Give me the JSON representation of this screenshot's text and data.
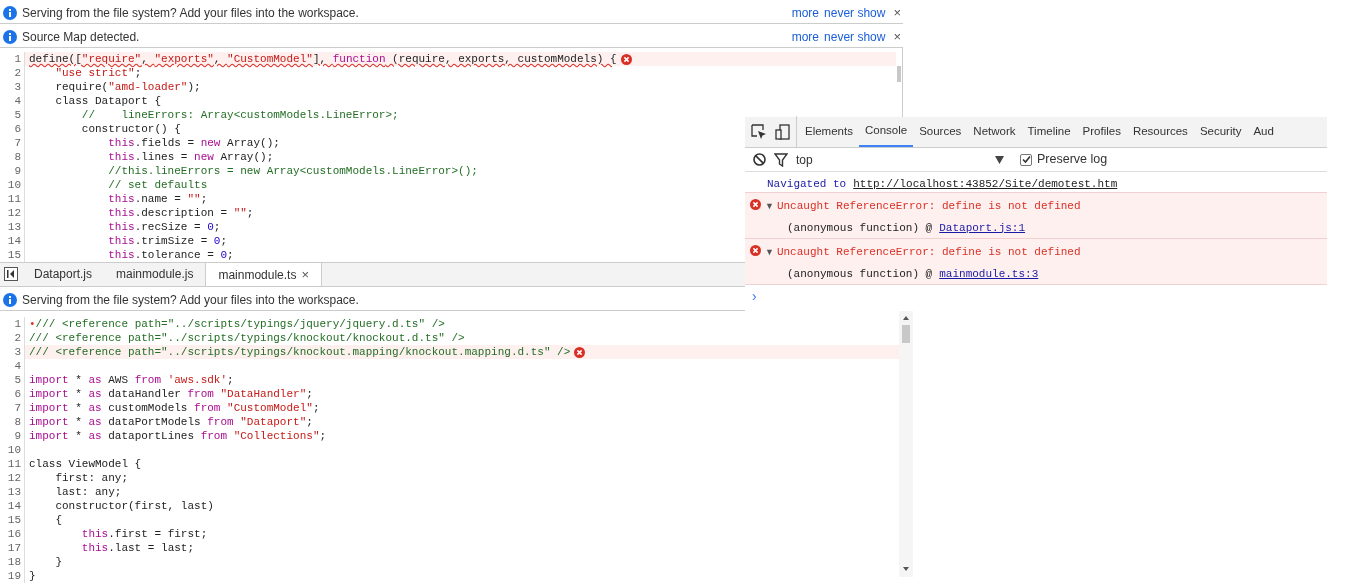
{
  "editor_top": {
    "info_bars": [
      {
        "text": "Serving from the file system? Add your files into the workspace.",
        "links": [
          "more",
          "never show"
        ],
        "close": "×"
      },
      {
        "text": "Source Map detected.",
        "links": [
          "more",
          "never show"
        ],
        "close": "×"
      }
    ],
    "lines": [
      {
        "number": "1",
        "error": true,
        "tokens": [
          {
            "kind": "plain",
            "text": "define(["
          },
          {
            "kind": "string",
            "text": "\"require\""
          },
          {
            "kind": "plain",
            "text": ", "
          },
          {
            "kind": "string",
            "text": "\"exports\""
          },
          {
            "kind": "plain",
            "text": ", "
          },
          {
            "kind": "string",
            "text": "\"CustomModel\""
          },
          {
            "kind": "plain",
            "text": "], "
          },
          {
            "kind": "keyword",
            "text": "function"
          },
          {
            "kind": "plain",
            "text": " (require, exports, customModels) {"
          }
        ]
      },
      {
        "number": "2",
        "error": false,
        "tokens": [
          {
            "kind": "string",
            "text": "    \"use strict\""
          },
          {
            "kind": "plain",
            "text": ";"
          }
        ]
      },
      {
        "number": "3",
        "error": false,
        "tokens": [
          {
            "kind": "plain",
            "text": "    require("
          },
          {
            "kind": "string",
            "text": "\"amd-loader\""
          },
          {
            "kind": "plain",
            "text": ");"
          }
        ]
      },
      {
        "number": "4",
        "error": false,
        "tokens": [
          {
            "kind": "plain",
            "text": "    class Dataport {"
          }
        ]
      },
      {
        "number": "5",
        "error": false,
        "tokens": [
          {
            "kind": "comment",
            "text": "        //    lineErrors: Array<customModels.LineError>;"
          }
        ]
      },
      {
        "number": "6",
        "error": false,
        "tokens": [
          {
            "kind": "plain",
            "text": "        constructor() {"
          }
        ]
      },
      {
        "number": "7",
        "error": false,
        "tokens": [
          {
            "kind": "keyword",
            "text": "            this"
          },
          {
            "kind": "plain",
            "text": ".fields = "
          },
          {
            "kind": "keyword",
            "text": "new"
          },
          {
            "kind": "plain",
            "text": " Array();"
          }
        ]
      },
      {
        "number": "8",
        "error": false,
        "tokens": [
          {
            "kind": "keyword",
            "text": "            this"
          },
          {
            "kind": "plain",
            "text": ".lines = "
          },
          {
            "kind": "keyword",
            "text": "new"
          },
          {
            "kind": "plain",
            "text": " Array();"
          }
        ]
      },
      {
        "number": "9",
        "error": false,
        "tokens": [
          {
            "kind": "comment",
            "text": "            //this.lineErrors = new Array<customModels.LineError>();"
          }
        ]
      },
      {
        "number": "10",
        "error": false,
        "tokens": [
          {
            "kind": "comment",
            "text": "            // set defaults"
          }
        ]
      },
      {
        "number": "11",
        "error": false,
        "tokens": [
          {
            "kind": "keyword",
            "text": "            this"
          },
          {
            "kind": "plain",
            "text": ".name = "
          },
          {
            "kind": "string",
            "text": "\"\""
          },
          {
            "kind": "plain",
            "text": ";"
          }
        ]
      },
      {
        "number": "12",
        "error": false,
        "tokens": [
          {
            "kind": "keyword",
            "text": "            this"
          },
          {
            "kind": "plain",
            "text": ".description = "
          },
          {
            "kind": "string",
            "text": "\"\""
          },
          {
            "kind": "plain",
            "text": ";"
          }
        ]
      },
      {
        "number": "13",
        "error": false,
        "tokens": [
          {
            "kind": "keyword",
            "text": "            this"
          },
          {
            "kind": "plain",
            "text": ".recSize = "
          },
          {
            "kind": "number",
            "text": "0"
          },
          {
            "kind": "plain",
            "text": ";"
          }
        ]
      },
      {
        "number": "14",
        "error": false,
        "tokens": [
          {
            "kind": "keyword",
            "text": "            this"
          },
          {
            "kind": "plain",
            "text": ".trimSize = "
          },
          {
            "kind": "number",
            "text": "0"
          },
          {
            "kind": "plain",
            "text": ";"
          }
        ]
      },
      {
        "number": "15",
        "error": false,
        "tokens": [
          {
            "kind": "keyword",
            "text": "            this"
          },
          {
            "kind": "plain",
            "text": ".tolerance = "
          },
          {
            "kind": "number",
            "text": "0"
          },
          {
            "kind": "plain",
            "text": ";"
          }
        ]
      }
    ]
  },
  "tabs": [
    {
      "label": "Dataport.js",
      "selected": false
    },
    {
      "label": "mainmodule.js",
      "selected": false
    },
    {
      "label": "mainmodule.ts",
      "selected": true,
      "close": "×"
    }
  ],
  "editor_bottom": {
    "info_bar": {
      "text": "Serving from the file system? Add your files into the workspace."
    },
    "lines": [
      {
        "number": "1",
        "error": false,
        "tokens": [
          {
            "kind": "error",
            "text": "•"
          },
          {
            "kind": "comment",
            "text": "/// <reference path=\"../scripts/typings/jquery/jquery.d.ts\" />"
          }
        ]
      },
      {
        "number": "2",
        "error": false,
        "tokens": [
          {
            "kind": "comment",
            "text": "/// <reference path=\"../scripts/typings/knockout/knockout.d.ts\" />"
          }
        ]
      },
      {
        "number": "3",
        "error": true,
        "tokens": [
          {
            "kind": "comment",
            "text": "/// <reference path=\"../scripts/typings/knockout.mapping/knockout.mapping.d.ts\" />"
          }
        ]
      },
      {
        "number": "4",
        "error": false
      },
      {
        "number": "5",
        "error": false,
        "tokens": [
          {
            "kind": "keyword",
            "text": "import"
          },
          {
            "kind": "plain",
            "text": " * "
          },
          {
            "kind": "keyword",
            "text": "as"
          },
          {
            "kind": "plain",
            "text": " AWS "
          },
          {
            "kind": "keyword",
            "text": "from"
          },
          {
            "kind": "string",
            "text": " 'aws.sdk'"
          },
          {
            "kind": "plain",
            "text": ";"
          }
        ]
      },
      {
        "number": "6",
        "error": false,
        "tokens": [
          {
            "kind": "keyword",
            "text": "import"
          },
          {
            "kind": "plain",
            "text": " * "
          },
          {
            "kind": "keyword",
            "text": "as"
          },
          {
            "kind": "plain",
            "text": " dataHandler "
          },
          {
            "kind": "keyword",
            "text": "from"
          },
          {
            "kind": "string",
            "text": " \"DataHandler\""
          },
          {
            "kind": "plain",
            "text": ";"
          }
        ]
      },
      {
        "number": "7",
        "error": false,
        "tokens": [
          {
            "kind": "keyword",
            "text": "import"
          },
          {
            "kind": "plain",
            "text": " * "
          },
          {
            "kind": "keyword",
            "text": "as"
          },
          {
            "kind": "plain",
            "text": " customModels "
          },
          {
            "kind": "keyword",
            "text": "from"
          },
          {
            "kind": "string",
            "text": " \"CustomModel\""
          },
          {
            "kind": "plain",
            "text": ";"
          }
        ]
      },
      {
        "number": "8",
        "error": false,
        "tokens": [
          {
            "kind": "keyword",
            "text": "import"
          },
          {
            "kind": "plain",
            "text": " * "
          },
          {
            "kind": "keyword",
            "text": "as"
          },
          {
            "kind": "plain",
            "text": " dataPortModels "
          },
          {
            "kind": "keyword",
            "text": "from"
          },
          {
            "kind": "string",
            "text": " \"Dataport\""
          },
          {
            "kind": "plain",
            "text": ";"
          }
        ]
      },
      {
        "number": "9",
        "error": false,
        "tokens": [
          {
            "kind": "keyword",
            "text": "import"
          },
          {
            "kind": "plain",
            "text": " * "
          },
          {
            "kind": "keyword",
            "text": "as"
          },
          {
            "kind": "plain",
            "text": " dataportLines "
          },
          {
            "kind": "keyword",
            "text": "from"
          },
          {
            "kind": "string",
            "text": " \"Collections\""
          },
          {
            "kind": "plain",
            "text": ";"
          }
        ]
      },
      {
        "number": "10",
        "error": false
      },
      {
        "number": "11",
        "error": false,
        "tokens": [
          {
            "kind": "plain",
            "text": "class ViewModel {"
          }
        ]
      },
      {
        "number": "12",
        "error": false,
        "tokens": [
          {
            "kind": "plain",
            "text": "    first: any;"
          }
        ]
      },
      {
        "number": "13",
        "error": false,
        "tokens": [
          {
            "kind": "plain",
            "text": "    last: any;"
          }
        ]
      },
      {
        "number": "14",
        "error": false,
        "tokens": [
          {
            "kind": "plain",
            "text": "    constructor(first, last)"
          }
        ]
      },
      {
        "number": "15",
        "error": false,
        "tokens": [
          {
            "kind": "plain",
            "text": "    {"
          }
        ]
      },
      {
        "number": "16",
        "error": false,
        "tokens": [
          {
            "kind": "keyword",
            "text": "        this"
          },
          {
            "kind": "plain",
            "text": ".first = first;"
          }
        ]
      },
      {
        "number": "17",
        "error": false,
        "tokens": [
          {
            "kind": "keyword",
            "text": "        this"
          },
          {
            "kind": "plain",
            "text": ".last = last;"
          }
        ]
      },
      {
        "number": "18",
        "error": false,
        "tokens": [
          {
            "kind": "plain",
            "text": "    }"
          }
        ]
      },
      {
        "number": "19",
        "error": false,
        "tokens": [
          {
            "kind": "plain",
            "text": "}"
          }
        ]
      }
    ]
  },
  "devtools": {
    "tabs": [
      {
        "label": "Elements",
        "selected": false
      },
      {
        "label": "Console",
        "selected": true
      },
      {
        "label": "Sources",
        "selected": false
      },
      {
        "label": "Network",
        "selected": false
      },
      {
        "label": "Timeline",
        "selected": false
      },
      {
        "label": "Profiles",
        "selected": false
      },
      {
        "label": "Resources",
        "selected": false
      },
      {
        "label": "Security",
        "selected": false
      },
      {
        "label": "Aud",
        "selected": false
      }
    ],
    "filter": {
      "context": "top",
      "preserve_log": {
        "label": "Preserve log",
        "checked": true
      }
    },
    "messages": [
      {
        "kind": "info",
        "text": "Navigated to",
        "link": "http://localhost:43852/Site/demotest.htm"
      },
      {
        "kind": "error",
        "toggle": "▼",
        "text": "Uncaught ReferenceError: define is not defined",
        "source": "(anonymous function) @",
        "link": "Dataport.js:1"
      },
      {
        "kind": "error",
        "toggle": "▼",
        "text": "Uncaught ReferenceError: define is not defined",
        "source": "(anonymous function) @",
        "link": "mainmodule.ts:3"
      }
    ],
    "prompt": "›"
  }
}
